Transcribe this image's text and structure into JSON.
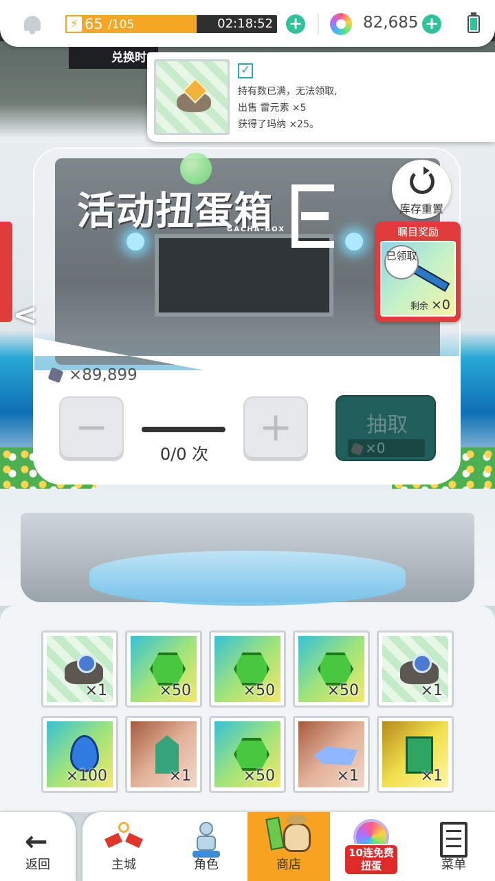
{
  "status_bar": {
    "energy_current": "65",
    "energy_max": "/105",
    "energy_fraction": 0.62,
    "energy_timer": "02:18:52",
    "gem_count": "82,685",
    "icons": [
      "bell-icon",
      "lightning-icon",
      "plus-icon",
      "rainbow-orb-icon",
      "plus-icon",
      "battery-icon"
    ]
  },
  "strip_label": "兑换时",
  "toast": {
    "line1": "持有数已满，无法领取,",
    "line2": "出售 雷元素 ×5",
    "line3": "获得了玛纳 ×25。"
  },
  "gacha": {
    "title": "活动扭蛋箱",
    "subtitle": "GACHA-BOX",
    "stock_reset_label": "库存重置",
    "eye_reward": {
      "title": "瞩目奖励",
      "claimed": "已领取",
      "remain_label": "剩余",
      "remain_count": "×0"
    },
    "currency_count": "×89,899",
    "draw_count": "0/0 次",
    "decrease_label": "−",
    "increase_label": "+",
    "draw_label": "抽取",
    "draw_cost": "×0",
    "prev_arrow": "<"
  },
  "items": [
    {
      "icon": "ore-icon",
      "bg": "green",
      "count": "×1"
    },
    {
      "icon": "green-gem-icon",
      "bg": "rainbow",
      "count": "×50"
    },
    {
      "icon": "green-gem-icon",
      "bg": "rainbow",
      "count": "×50"
    },
    {
      "icon": "green-gem-icon",
      "bg": "rainbow",
      "count": "×50"
    },
    {
      "icon": "ore-icon",
      "bg": "green",
      "count": "×1"
    },
    {
      "icon": "water-drop-icon",
      "bg": "rainbow",
      "count": "×100"
    },
    {
      "icon": "crystal-cluster-icon",
      "bg": "brown",
      "count": "×1"
    },
    {
      "icon": "green-gem-icon",
      "bg": "rainbow",
      "count": "×50"
    },
    {
      "icon": "blue-crystal-icon",
      "bg": "brown",
      "count": "×1"
    },
    {
      "icon": "emerald-icon",
      "bg": "gold",
      "count": "×1"
    }
  ],
  "nav": {
    "back": "返回",
    "tabs": [
      "主城",
      "角色",
      "商店",
      "",
      "菜单"
    ],
    "active": "商店",
    "gacha_badge": "10连免费扭蛋"
  },
  "colors": {
    "accent_green": "#2ec39a",
    "energy_orange": "#f5a623",
    "reward_red": "#e23b3b",
    "nav_active": "#f7a321"
  }
}
